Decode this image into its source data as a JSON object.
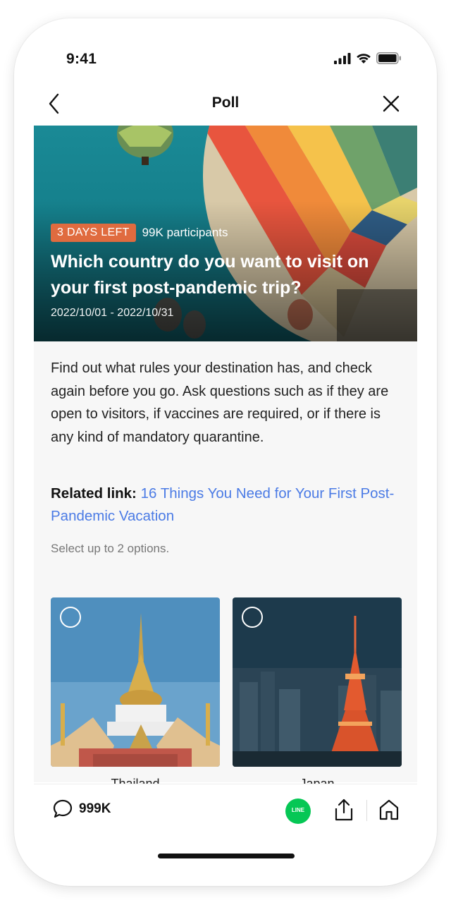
{
  "status_bar": {
    "time": "9:41"
  },
  "nav": {
    "title": "Poll"
  },
  "hero": {
    "days_left": "3 DAYS LEFT",
    "participants": "99K participants",
    "title": "Which country do you want to visit on your first post-pandemic trip?",
    "dates": "2022/10/01 - 2022/10/31"
  },
  "description": "Find out what rules your destination has, and check again before you go. Ask questions such as if they are open to visitors, if vaccines are required, or if there is any kind of mandatory quarantine.",
  "related": {
    "label": "Related link:",
    "link_text": "16 Things You Need for Your First Post-Pandemic Vacation"
  },
  "select_hint": "Select up to 2 options.",
  "options": [
    {
      "label": "Thailand",
      "selected": false
    },
    {
      "label": "Japan",
      "selected": false
    }
  ],
  "bottom_bar": {
    "comment_count": "999K",
    "line_label": "LINE"
  },
  "colors": {
    "badge": "#e06b3f",
    "link": "#4b7be5",
    "line_green": "#06c755"
  }
}
